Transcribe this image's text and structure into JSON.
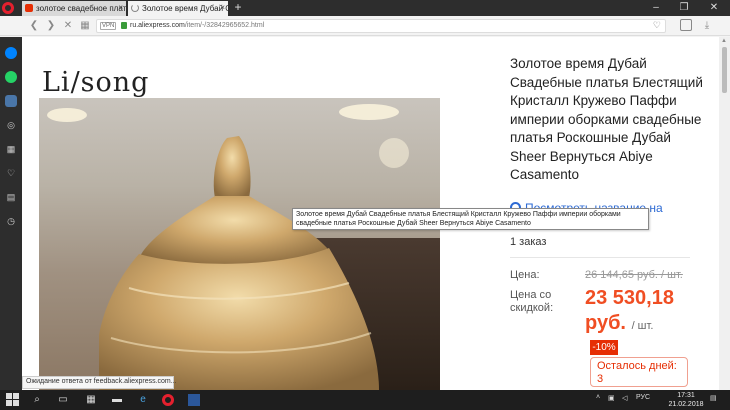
{
  "browser": {
    "tabs": [
      {
        "title": "золотое свадебное платья"
      },
      {
        "title": "Золотое время Дубай Св"
      }
    ],
    "new_tab": "+",
    "address": {
      "vpn": "VPN",
      "host": "ru.aliexpress.com",
      "path": "/item/-/32842965652.html"
    },
    "window_controls": [
      "–",
      "❐",
      "✕"
    ],
    "status_text": "Ожидание ответа от feedback.aliexpress.com..."
  },
  "product": {
    "brand": "Li/song",
    "title": "Золотое время Дубай Свадебные платья Блестящий Кристалл Кружево Паффи империи оборками свадебные платья Роскошные Дубай Sheer Вернуться Abiye Casamento",
    "translate_link": "Посмотреть название на",
    "orders": "1 заказ",
    "price_label": "Цена:",
    "old_price": "26 144,65 руб. / шт.",
    "discount_label": "Цена со скидкой:",
    "new_price": "23 530,18 руб.",
    "per_unit": "/ шт.",
    "discount_badge": "-10%",
    "days_left": "Осталось дней: 3"
  },
  "tooltip": {
    "text": "Золотое время Дубай Свадебные платья Блестящий Кристалл Кружево Паффи империи оборками свадебные платья Роскошные Дубай Sheer Вернуться Abiye Casamento"
  },
  "taskbar": {
    "lang": "РУС",
    "time": "17:31",
    "date": "21.02.2018"
  },
  "colors": {
    "accent": "#e62e04",
    "price": "#f04e23",
    "link": "#2e6bd4"
  }
}
